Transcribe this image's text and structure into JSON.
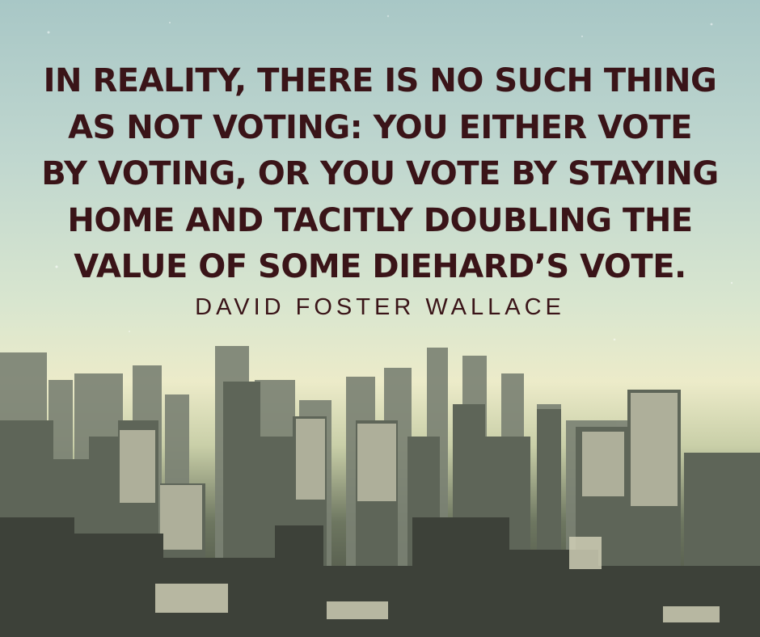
{
  "quote": {
    "lines": [
      "IN REALITY, THERE IS NO SUCH THING",
      "AS NOT VOTING: YOU EITHER VOTE",
      "BY VOTING, OR YOU VOTE BY STAYING",
      "HOME AND TACITLY DOUBLING THE",
      "VALUE OF SOME DIEHARD’S VOTE."
    ],
    "author": "DAVID FOSTER WALLACE"
  },
  "colors": {
    "text": "#3a1418",
    "sky_top": "#a8c7c6",
    "horizon": "#ecebc9",
    "buildings": "#555a4e"
  }
}
